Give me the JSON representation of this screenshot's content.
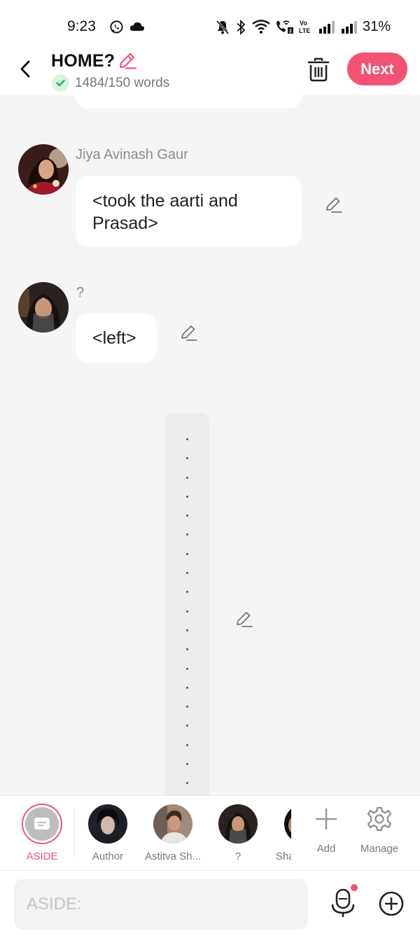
{
  "status_bar": {
    "time": "9:23",
    "battery": "31%",
    "icons": [
      "whatsapp-icon",
      "cloud-icon",
      "mute-icon",
      "bluetooth-icon",
      "wifi-icon",
      "wifi-call-icon",
      "volte-icon",
      "signal-icon",
      "signal-icon"
    ]
  },
  "header": {
    "title": "HOME?",
    "word_count": "1484/150 words",
    "next_label": "Next",
    "accent_color": "#f25374"
  },
  "messages": [
    {
      "speaker": "Jiya Avinash Gaur",
      "text": "<took the aarti and Prasad>"
    },
    {
      "speaker": "?",
      "text": "<left>"
    }
  ],
  "characters": [
    {
      "label": "ASIDE",
      "selected": true
    },
    {
      "label": "Author"
    },
    {
      "label": "Astitva Sh..."
    },
    {
      "label": "?"
    },
    {
      "label": "Sha"
    },
    {
      "label": "Add"
    },
    {
      "label": "Manage"
    }
  ],
  "input": {
    "placeholder": "ASIDE:"
  }
}
